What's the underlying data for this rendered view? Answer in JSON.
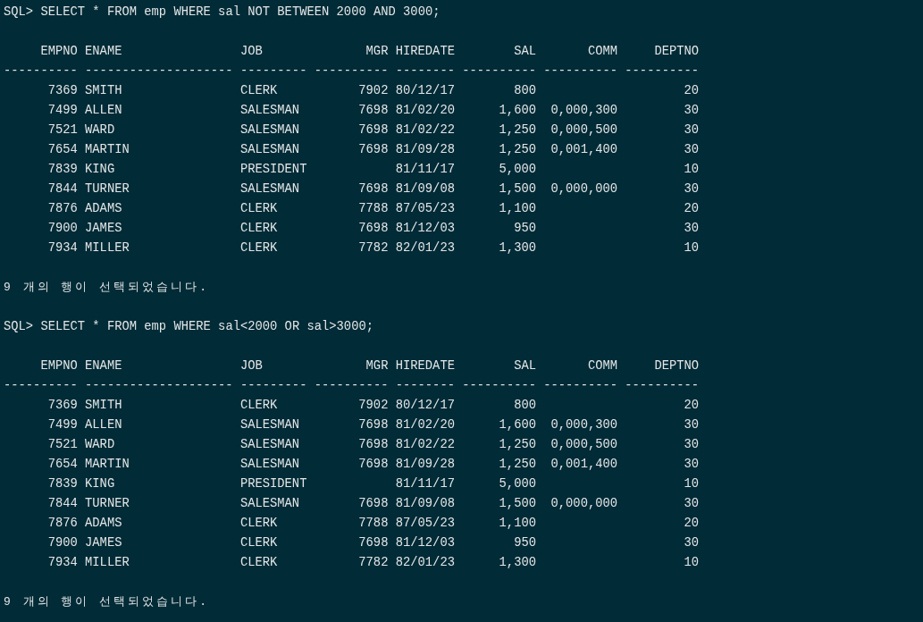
{
  "queries": [
    {
      "command": "SQL> SELECT * FROM emp WHERE sal NOT BETWEEN 2000 AND 3000;",
      "columns": [
        "EMPNO",
        "ENAME",
        "JOB",
        "MGR",
        "HIREDATE",
        "SAL",
        "COMM",
        "DEPTNO"
      ],
      "separators": [
        "----------",
        "--------------------",
        "---------",
        "----------",
        "--------",
        "----------",
        "----------",
        "----------"
      ],
      "rows": [
        [
          "7369",
          "SMITH",
          "CLERK",
          "7902",
          "80/12/17",
          "800",
          "",
          "20"
        ],
        [
          "7499",
          "ALLEN",
          "SALESMAN",
          "7698",
          "81/02/20",
          "1,600",
          "0,000,300",
          "30"
        ],
        [
          "7521",
          "WARD",
          "SALESMAN",
          "7698",
          "81/02/22",
          "1,250",
          "0,000,500",
          "30"
        ],
        [
          "7654",
          "MARTIN",
          "SALESMAN",
          "7698",
          "81/09/28",
          "1,250",
          "0,001,400",
          "30"
        ],
        [
          "7839",
          "KING",
          "PRESIDENT",
          "",
          "81/11/17",
          "5,000",
          "",
          "10"
        ],
        [
          "7844",
          "TURNER",
          "SALESMAN",
          "7698",
          "81/09/08",
          "1,500",
          "0,000,000",
          "30"
        ],
        [
          "7876",
          "ADAMS",
          "CLERK",
          "7788",
          "87/05/23",
          "1,100",
          "",
          "20"
        ],
        [
          "7900",
          "JAMES",
          "CLERK",
          "7698",
          "81/12/03",
          "950",
          "",
          "30"
        ],
        [
          "7934",
          "MILLER",
          "CLERK",
          "7782",
          "82/01/23",
          "1,300",
          "",
          "10"
        ]
      ],
      "message": "9 개의 행이 선택되었습니다."
    },
    {
      "command": "SQL> SELECT * FROM emp WHERE sal<2000 OR sal>3000;",
      "columns": [
        "EMPNO",
        "ENAME",
        "JOB",
        "MGR",
        "HIREDATE",
        "SAL",
        "COMM",
        "DEPTNO"
      ],
      "separators": [
        "----------",
        "--------------------",
        "---------",
        "----------",
        "--------",
        "----------",
        "----------",
        "----------"
      ],
      "rows": [
        [
          "7369",
          "SMITH",
          "CLERK",
          "7902",
          "80/12/17",
          "800",
          "",
          "20"
        ],
        [
          "7499",
          "ALLEN",
          "SALESMAN",
          "7698",
          "81/02/20",
          "1,600",
          "0,000,300",
          "30"
        ],
        [
          "7521",
          "WARD",
          "SALESMAN",
          "7698",
          "81/02/22",
          "1,250",
          "0,000,500",
          "30"
        ],
        [
          "7654",
          "MARTIN",
          "SALESMAN",
          "7698",
          "81/09/28",
          "1,250",
          "0,001,400",
          "30"
        ],
        [
          "7839",
          "KING",
          "PRESIDENT",
          "",
          "81/11/17",
          "5,000",
          "",
          "10"
        ],
        [
          "7844",
          "TURNER",
          "SALESMAN",
          "7698",
          "81/09/08",
          "1,500",
          "0,000,000",
          "30"
        ],
        [
          "7876",
          "ADAMS",
          "CLERK",
          "7788",
          "87/05/23",
          "1,100",
          "",
          "20"
        ],
        [
          "7900",
          "JAMES",
          "CLERK",
          "7698",
          "81/12/03",
          "950",
          "",
          "30"
        ],
        [
          "7934",
          "MILLER",
          "CLERK",
          "7782",
          "82/01/23",
          "1,300",
          "",
          "10"
        ]
      ],
      "message": "9 개의 행이 선택되었습니다."
    }
  ]
}
